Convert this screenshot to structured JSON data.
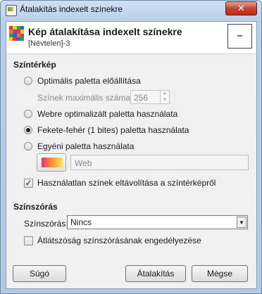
{
  "window": {
    "title": "Átalakítás indexelt színekre",
    "close_glyph": "✕"
  },
  "header": {
    "title": "Kép átalakítása indexelt színekre",
    "subtitle": "[Névtelen]-3"
  },
  "colormap": {
    "section_title": "Színtérkép",
    "options": [
      {
        "label": "Optimális paletta előállítása",
        "checked": false
      },
      {
        "label": "Webre optimalizált paletta használata",
        "checked": false
      },
      {
        "label": "Fekete-fehér (1 bites) paletta használata",
        "checked": true
      },
      {
        "label": "Egyéni paletta használata",
        "checked": false
      }
    ],
    "max_colors_label": "Színek maximális száma:",
    "max_colors_value": "256",
    "custom_palette_name": "Web",
    "remove_unused_label": "Használatlan színek eltávolítása a színtérképről",
    "remove_unused_checked": true
  },
  "dithering": {
    "section_title": "Színszórás",
    "dither_label": "Színszórás:",
    "dither_value": "Nincs",
    "transparency_label": "Átlátszóság színszórásának engedélyezése",
    "transparency_checked": false
  },
  "buttons": {
    "help": "Súgó",
    "convert": "Átalakítás",
    "cancel": "Mégse"
  },
  "colors": {
    "accent": "#c7432f",
    "palette_gradient": [
      "#e8307a",
      "#ff8a3d",
      "#ffe94a"
    ]
  }
}
